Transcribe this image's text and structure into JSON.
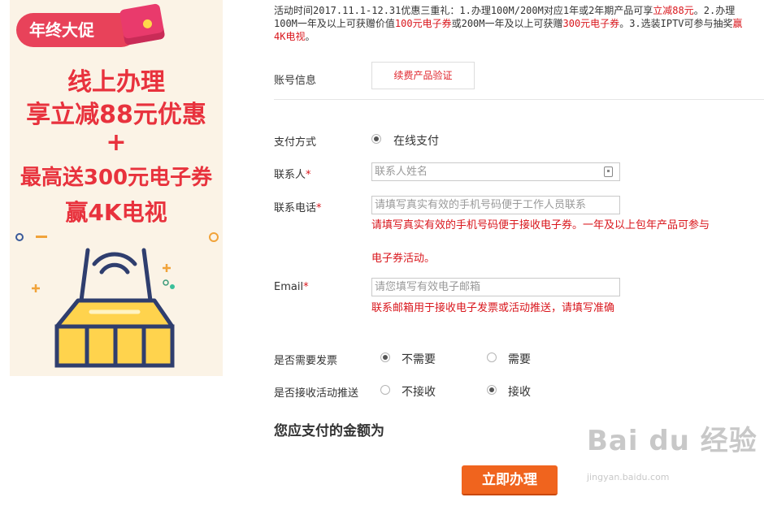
{
  "banner": {
    "badge": "年终大促",
    "line1": "线上办理",
    "line2": "享立减88元优惠",
    "line3": "+",
    "line4": "最高送300元电子券",
    "line5": "赢4K电视"
  },
  "info": {
    "t1": "活动时间2017.11.1-12.31优惠三重礼：1.办理100M/200M对应1年或2年期产品可享",
    "r1": "立减88元",
    "t2": "。2.办理100M一年及以上可获赠价值",
    "r2": "100元电子券",
    "t3": "或200M一年及以上可获赠",
    "r3": "300元电子券",
    "t4": "。3.选装IPTV可参与抽奖",
    "r4": "赢4K电视",
    "t5": "。"
  },
  "account": {
    "label": "账号信息",
    "verify_button": "续费产品验证"
  },
  "payment": {
    "label": "支付方式",
    "option": "在线支付"
  },
  "contact": {
    "label": "联系人",
    "required": "*",
    "placeholder": "联系人姓名"
  },
  "phone": {
    "label": "联系电话",
    "required": "*",
    "placeholder": "请填写真实有效的手机号码便于工作人员联系",
    "hint1": "请填写真实有效的手机号码便于接收电子券。一年及以上包年产品可参与",
    "hint2": "电子券活动。"
  },
  "email": {
    "label": "Email",
    "required": "*",
    "placeholder": "请您填写有效电子邮箱",
    "hint": "联系邮箱用于接收电子发票或活动推送，请填写准确"
  },
  "invoice": {
    "label": "是否需要发票",
    "opt_no": "不需要",
    "opt_yes": "需要",
    "selected": "不需要"
  },
  "promo": {
    "label": "是否接收活动推送",
    "opt_no": "不接收",
    "opt_yes": "接收",
    "selected": "接收"
  },
  "amount_label": "您应支付的金额为",
  "submit_button": "立即办理",
  "watermark": {
    "main": "Bai du 经验",
    "sub": "jingyan.baidu.com"
  }
}
